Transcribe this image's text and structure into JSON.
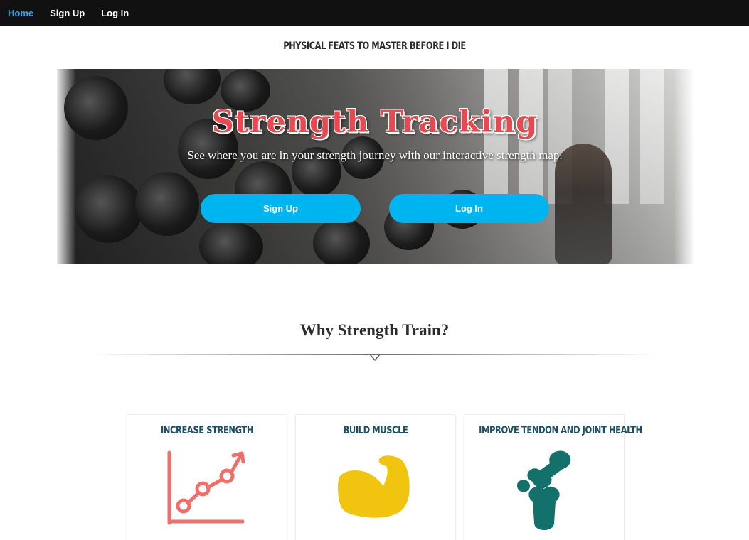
{
  "nav": {
    "home_label": "Home",
    "signup_label": "Sign Up",
    "login_label": "Log In",
    "active_color": "#2fa4e7"
  },
  "tagline": "PHYSICAL FEATS TO MASTER BEFORE I DIE",
  "hero": {
    "title": "Strength Tracking",
    "subtitle": "See where you are in your strength journey with our interactive strength map.",
    "signup_button": "Sign Up",
    "login_button": "Log In",
    "button_color": "#00b4ef",
    "title_color": "#e8484f"
  },
  "why": {
    "heading": "Why Strength Train?"
  },
  "cards": [
    {
      "title": "INCREASE STRENGTH",
      "icon": "line-graph-icon",
      "icon_color": "#ef6f6a"
    },
    {
      "title": "BUILD MUSCLE",
      "icon": "flexed-arm-icon",
      "icon_color": "#f1c40f"
    },
    {
      "title": "IMPROVE TENDON AND JOINT HEALTH",
      "icon": "knee-joint-icon",
      "icon_color": "#14706a"
    }
  ]
}
